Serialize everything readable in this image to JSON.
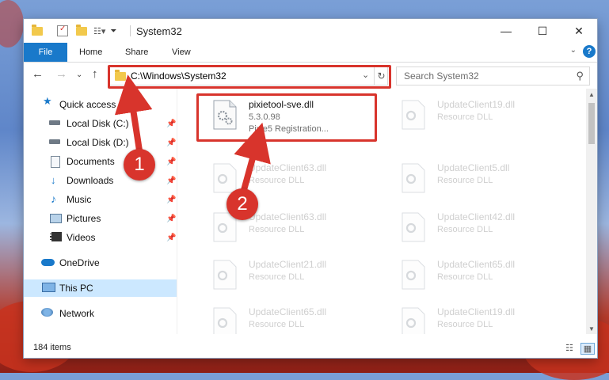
{
  "window": {
    "title": "System32",
    "controls": {
      "minimize": "—",
      "maximize": "☐",
      "close": "✕"
    }
  },
  "ribbon": {
    "file": "File",
    "tabs": [
      "Home",
      "Share",
      "View"
    ],
    "help": "?"
  },
  "address": {
    "path": "C:\\Windows\\System32",
    "search_placeholder": "Search System32"
  },
  "sidebar": {
    "items": [
      {
        "label": "Quick access",
        "icon": "star-icon",
        "pinned": false
      },
      {
        "label": "Local Disk (C:)",
        "icon": "drive-icon",
        "pinned": true
      },
      {
        "label": "Local Disk (D:)",
        "icon": "drive-icon",
        "pinned": true
      },
      {
        "label": "Documents",
        "icon": "document-icon",
        "pinned": true
      },
      {
        "label": "Downloads",
        "icon": "download-icon",
        "pinned": true
      },
      {
        "label": "Music",
        "icon": "music-icon",
        "pinned": true
      },
      {
        "label": "Pictures",
        "icon": "pictures-icon",
        "pinned": true
      },
      {
        "label": "Videos",
        "icon": "video-icon",
        "pinned": true
      },
      {
        "label": "OneDrive",
        "icon": "cloud-icon",
        "pinned": false
      },
      {
        "label": "This PC",
        "icon": "computer-icon",
        "pinned": false,
        "selected": true
      },
      {
        "label": "Network",
        "icon": "network-icon",
        "pinned": false
      }
    ]
  },
  "files": [
    {
      "name": "pixietool-sve.dll",
      "line2": "5.3.0.98",
      "line3": "Pixie5 Registration...",
      "highlighted": true
    },
    {
      "name": "UpdateClient19.dll",
      "line2": "Resource DLL"
    },
    {
      "name": "UpdateClient63.dll",
      "line2": "Resource DLL"
    },
    {
      "name": "UpdateClient5.dll",
      "line2": "Resource DLL"
    },
    {
      "name": "UpdateClient63.dll",
      "line2": "Resource DLL"
    },
    {
      "name": "UpdateClient42.dll",
      "line2": "Resource DLL"
    },
    {
      "name": "UpdateClient21.dll",
      "line2": "Resource DLL"
    },
    {
      "name": "UpdateClient65.dll",
      "line2": "Resource DLL"
    },
    {
      "name": "UpdateClient65.dll",
      "line2": "Resource DLL"
    },
    {
      "name": "UpdateClient19.dll",
      "line2": "Resource DLL"
    }
  ],
  "status": {
    "item_count": "184 items"
  },
  "callouts": [
    "1",
    "2"
  ],
  "colors": {
    "accent": "#1979ca",
    "highlight": "#d8342c",
    "selected": "#cce8ff"
  }
}
